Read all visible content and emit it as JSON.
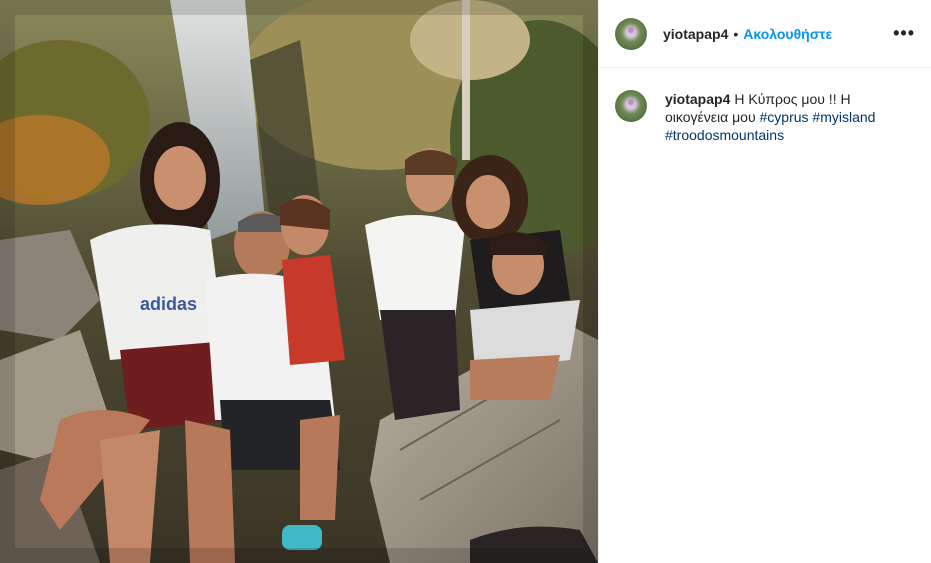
{
  "post": {
    "username": "yiotapap4",
    "separator": "•",
    "follow_label": "Ακολουθήστε",
    "more_icon": "•••",
    "caption_text": "Η Κύπρος μου !! Η οικογένεια μου",
    "hashtags": [
      "#cyprus",
      "#myisland",
      "#troodosmountains"
    ],
    "photo_shirt_text": "adidas"
  },
  "colors": {
    "follow": "#0095f6",
    "hashtag": "#00376b",
    "text": "#262626"
  }
}
